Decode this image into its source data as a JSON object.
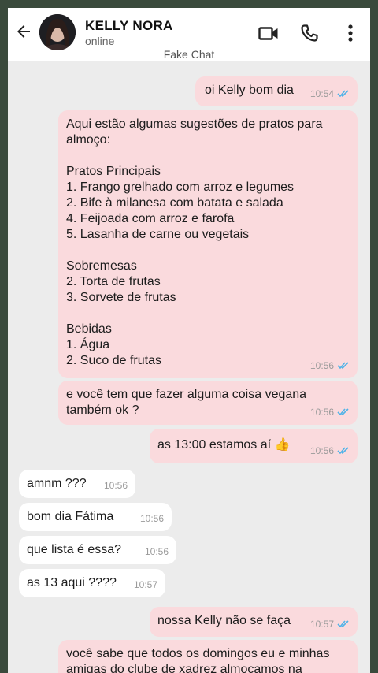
{
  "header": {
    "contact_name": "KELLY NORA",
    "status": "online",
    "subtitle": "Fake Chat",
    "icons": [
      "back-arrow-icon",
      "avatar",
      "video-call-icon",
      "phone-icon",
      "more-vert-icon"
    ]
  },
  "colors": {
    "outgoing_bubble": "#fadadd",
    "incoming_bubble": "#ffffff",
    "read_tick": "#4fb3e8",
    "chat_background": "#ececec"
  },
  "messages": [
    {
      "direction": "out",
      "text": "oi Kelly bom dia",
      "time": "10:54",
      "ticks": "read"
    },
    {
      "direction": "out",
      "text": "Aqui estão algumas sugestões de pratos para almoço:\n\nPratos Principais\n1. Frango grelhado com arroz e legumes\n2. Bife à milanesa com batata e salada\n4. Feijoada com arroz e farofa\n5. Lasanha de carne ou vegetais\n\nSobremesas\n2. Torta de frutas\n3. Sorvete de frutas\n\nBebidas\n1. Água\n2. Suco de frutas",
      "time": "10:56",
      "ticks": "read"
    },
    {
      "direction": "out",
      "text": "e você tem que fazer alguma coisa vegana também ok ?",
      "time": "10:56",
      "ticks": "read"
    },
    {
      "direction": "out",
      "text": "as 13:00 estamos aí 👍",
      "time": "10:56",
      "ticks": "read"
    },
    {
      "direction": "in",
      "text": "amnm ???",
      "time": "10:56"
    },
    {
      "direction": "in",
      "text": "bom dia Fátima",
      "time": "10:56"
    },
    {
      "direction": "in",
      "text": "que lista é essa?",
      "time": "10:56"
    },
    {
      "direction": "in",
      "text": "as 13 aqui ????",
      "time": "10:57"
    },
    {
      "direction": "out",
      "text": "nossa Kelly não se faça",
      "time": "10:57",
      "ticks": "read"
    },
    {
      "direction": "out",
      "text": "você sabe que todos os domingos eu e minhas amigas do clube de xadrez almoçamos na",
      "time": "",
      "ticks": ""
    }
  ]
}
